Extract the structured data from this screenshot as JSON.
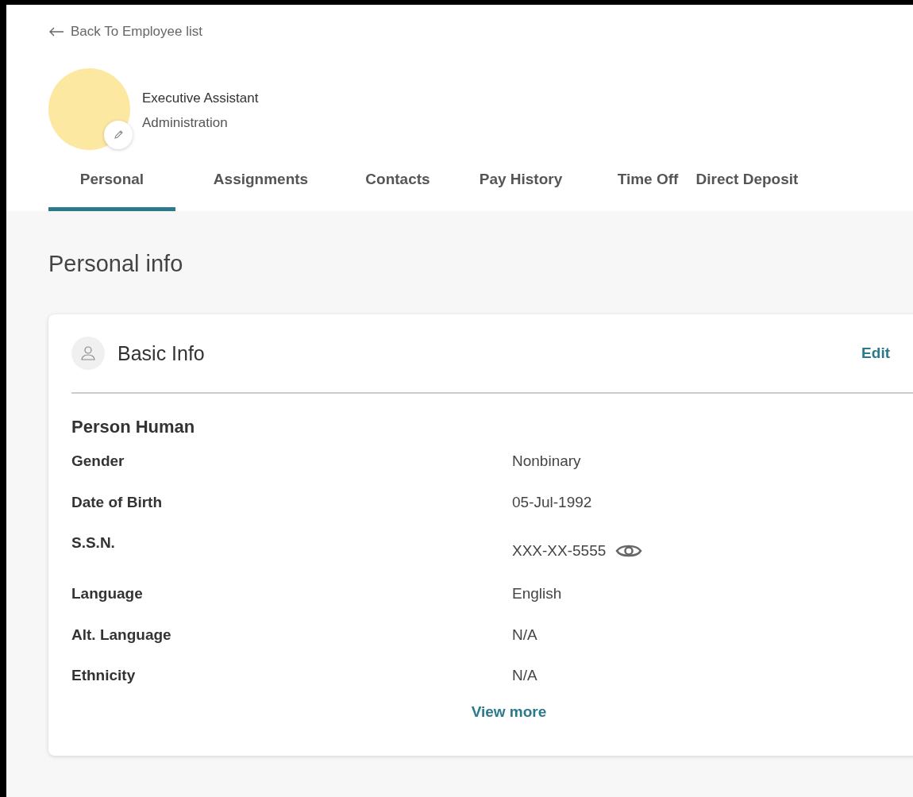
{
  "back_link": {
    "label": "Back To Employee list"
  },
  "profile": {
    "title": "Executive Assistant",
    "department": "Administration"
  },
  "tabs": [
    {
      "label": "Personal",
      "selected": true
    },
    {
      "label": "Assignments",
      "selected": false
    },
    {
      "label": "Contacts",
      "selected": false
    },
    {
      "label": "Pay History",
      "selected": false
    },
    {
      "label": "Time Off",
      "selected": false
    },
    {
      "label": "Direct Deposit",
      "selected": false
    }
  ],
  "section_title": "Personal info",
  "card": {
    "title": "Basic Info",
    "edit": "Edit",
    "name": "Person Human",
    "fields": [
      {
        "label": "Gender",
        "value": "Nonbinary",
        "kind": "text"
      },
      {
        "label": "Date of Birth",
        "value": "05-Jul-1992",
        "kind": "text"
      },
      {
        "label": "S.S.N.",
        "value": "XXX-XX-5555",
        "kind": "masked"
      },
      {
        "label": "Language",
        "value": "English",
        "kind": "text"
      },
      {
        "label": "Alt. Language",
        "value": "N/A",
        "kind": "text"
      },
      {
        "label": "Ethnicity",
        "value": "N/A",
        "kind": "text"
      }
    ],
    "view_more": "View more"
  }
}
